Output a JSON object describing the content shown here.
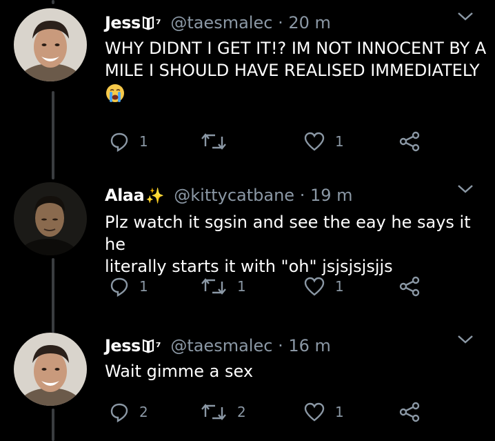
{
  "tweets": [
    {
      "name": "Jess",
      "badge": "⁷",
      "handle": "@taesmalec",
      "dot": "·",
      "time": "20 m",
      "text_lines": [
        "WHY DIDNT I GET IT!? IM NOT INNOCENT BY A",
        "MILE I SHOULD HAVE REALISED IMMEDIATELY"
      ],
      "emoji": "crying-face-emoji",
      "replies": "1",
      "retweets": "",
      "likes": "1"
    },
    {
      "name": "Alaa",
      "badge": "✨",
      "handle": "@kittycatbane",
      "dot": "·",
      "time": "19 m",
      "text_lines": [
        "Plz watch it sgsin and see the eay he says it he",
        "literally starts it with \"oh\" jsjsjsjsjjs"
      ],
      "replies": "1",
      "retweets": "1",
      "likes": "1"
    },
    {
      "name": "Jess",
      "badge": "⁷",
      "handle": "@taesmalec",
      "dot": "·",
      "time": "16 m",
      "text_lines": [
        "Wait gimme a sex"
      ],
      "replies": "2",
      "retweets": "2",
      "likes": "1"
    }
  ],
  "colors": {
    "background": "#000000",
    "text": "#ffffff",
    "muted": "#8b98a5",
    "thread": "#3a3d40"
  }
}
